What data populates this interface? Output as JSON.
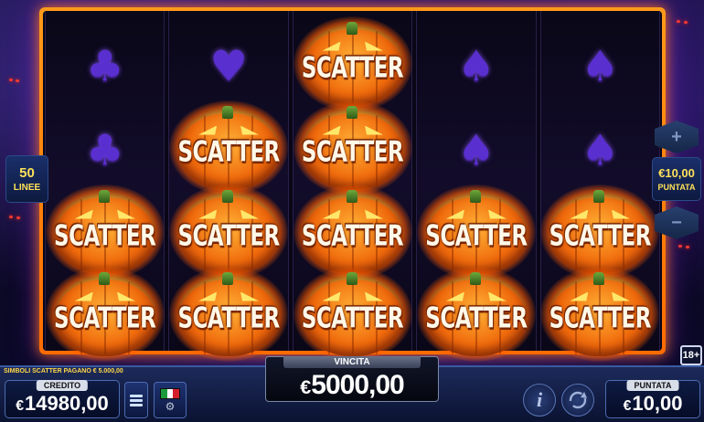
{
  "game": {
    "reels": [
      [
        "club",
        "club",
        "scatter",
        "scatter"
      ],
      [
        "heart",
        "scatter",
        "scatter",
        "scatter"
      ],
      [
        "scatter",
        "scatter",
        "scatter",
        "scatter"
      ],
      [
        "spade",
        "spade",
        "scatter",
        "scatter"
      ],
      [
        "spade",
        "spade",
        "scatter",
        "scatter"
      ]
    ],
    "scatter_label": "SCATTER",
    "suits": {
      "club": "♣",
      "heart": "♥",
      "spade": "♠"
    }
  },
  "left_panel": {
    "lines_value": "50",
    "lines_label": "LINEE"
  },
  "right_panel": {
    "increase_label": "+",
    "decrease_label": "−",
    "bet_value": "€10,00",
    "bet_label": "PUNTATA",
    "age_badge": "18+"
  },
  "bottom": {
    "scatter_note": "SIMBOLI SCATTER PAGANO € 5.000,00",
    "credit_label": "CREDITO",
    "credit_currency": "€",
    "credit_value": "14980,00",
    "win_label": "VINCITA",
    "win_currency": "€",
    "win_value": "5000,00",
    "bet_label": "PUNTATA",
    "bet_currency": "€",
    "bet_value": "10,00",
    "info_label": "i"
  },
  "colors": {
    "frame": "#ff7a00",
    "suit": "#5a2fd0",
    "accent_text": "#ffe15a",
    "flag_green": "#1c9a3c",
    "flag_white": "#ffffff",
    "flag_red": "#d21f2a"
  }
}
